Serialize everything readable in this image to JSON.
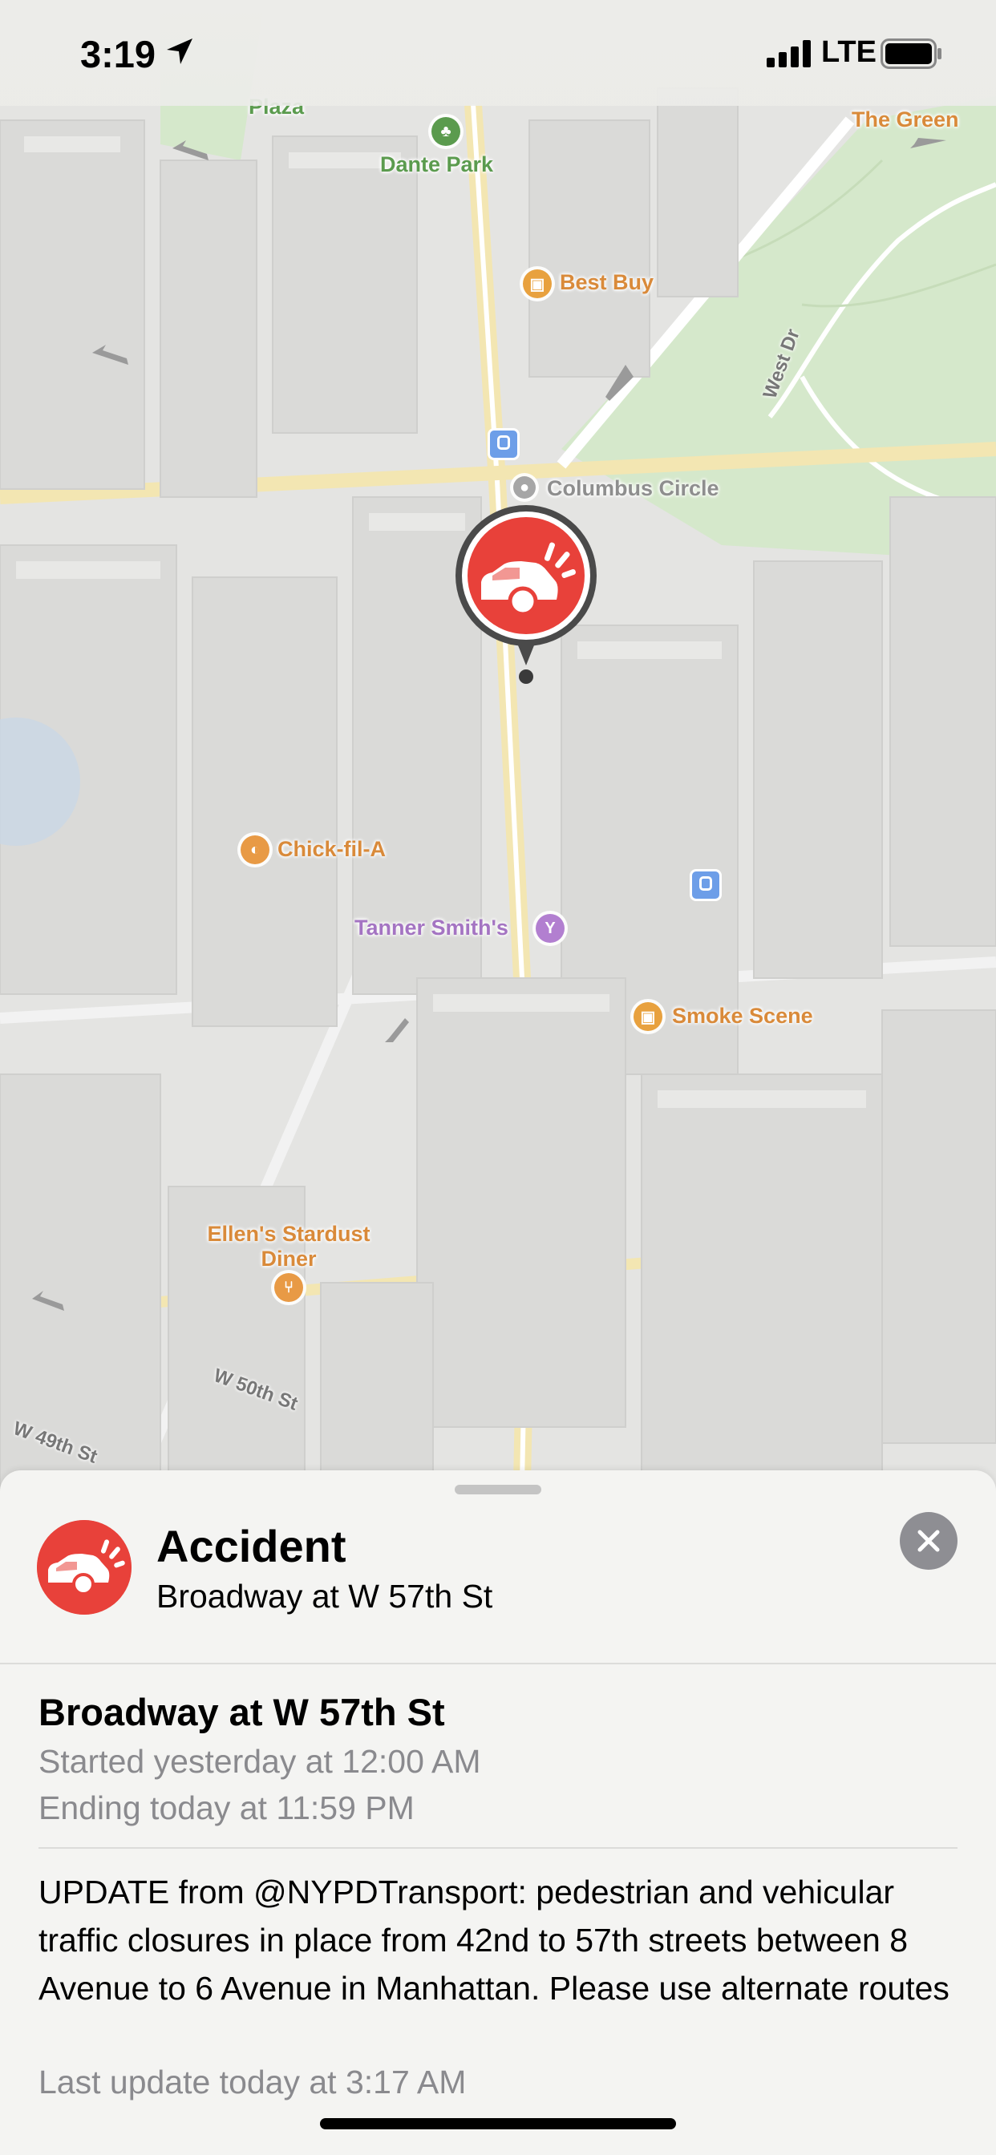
{
  "status_bar": {
    "time": "3:19",
    "carrier": "LTE",
    "icons": [
      "location-arrow-icon",
      "signal-icon",
      "battery-icon"
    ]
  },
  "map": {
    "pois": [
      {
        "label": "Plaza",
        "category": "park"
      },
      {
        "label": "Dante Park",
        "category": "park"
      },
      {
        "label": "The Green",
        "category": "park"
      },
      {
        "label": "Best Buy",
        "category": "shopping"
      },
      {
        "label": "Columbus Circle",
        "category": "landmark"
      },
      {
        "label": "Chick-fil-A",
        "category": "food"
      },
      {
        "label": "Tanner Smith's",
        "category": "bar"
      },
      {
        "label": "Smoke Scene",
        "category": "shopping"
      },
      {
        "label": "Ellen's Stardust Diner",
        "category": "restaurant"
      }
    ],
    "streets": [
      "West Dr",
      "W 50th St",
      "W 49th St"
    ],
    "pin": {
      "icon": "car-accident-icon",
      "color": "#e8413a"
    }
  },
  "sheet": {
    "title": "Accident",
    "subtitle": "Broadway at W 57th St",
    "icon": "car-accident-icon",
    "close_icon": "close-icon",
    "detail": {
      "location": "Broadway at W 57th St",
      "started": "Started yesterday at 12:00 AM",
      "ending": "Ending today at 11:59 PM",
      "description": "UPDATE from @NYPDTransport: pedestrian and vehicular traffic closures in place from 42nd to 57th streets between 8 Avenue to 6 Avenue in Manhattan. Please use alternate routes",
      "last_update": "Last update today at 3:17 AM"
    }
  },
  "colors": {
    "accent_red": "#e8413a",
    "park_green": "#d9ead0",
    "building": "#dedede",
    "poi_orange": "#e89a45"
  }
}
